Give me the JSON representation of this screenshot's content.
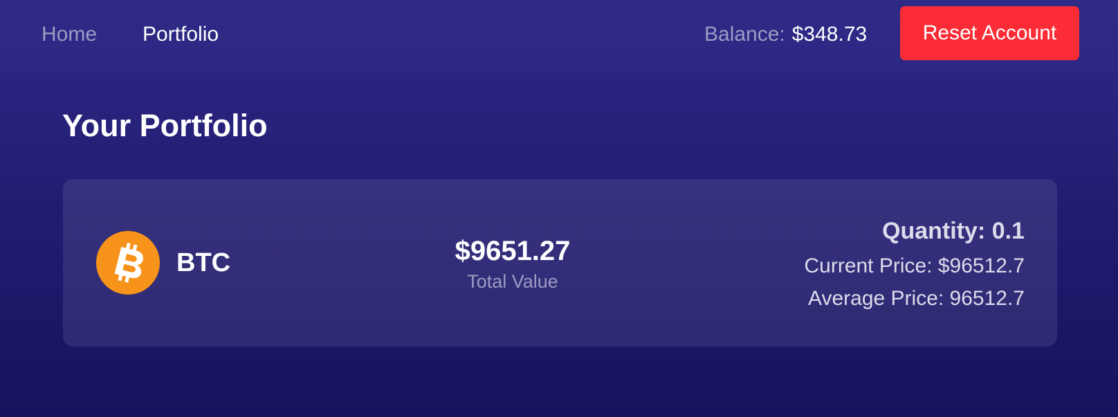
{
  "nav": {
    "links": [
      {
        "label": "Home",
        "active": false
      },
      {
        "label": "Portfolio",
        "active": true
      }
    ],
    "balance_label": "Balance:",
    "balance_value": "$348.73",
    "reset_label": "Reset Account"
  },
  "page": {
    "title": "Your Portfolio"
  },
  "holdings": [
    {
      "icon": "bitcoin-icon",
      "symbol": "BTC",
      "total_value": "$9651.27",
      "total_value_label": "Total Value",
      "quantity": "Quantity: 0.1",
      "current_price": "Current Price: $96512.7",
      "average_price": "Average Price: 96512.7"
    }
  ],
  "colors": {
    "background_top": "#2d2a84",
    "background_bottom": "#17135f",
    "reset_button": "#fb2c36",
    "bitcoin": "#f7931a",
    "muted_text": "#9d9cc4"
  }
}
